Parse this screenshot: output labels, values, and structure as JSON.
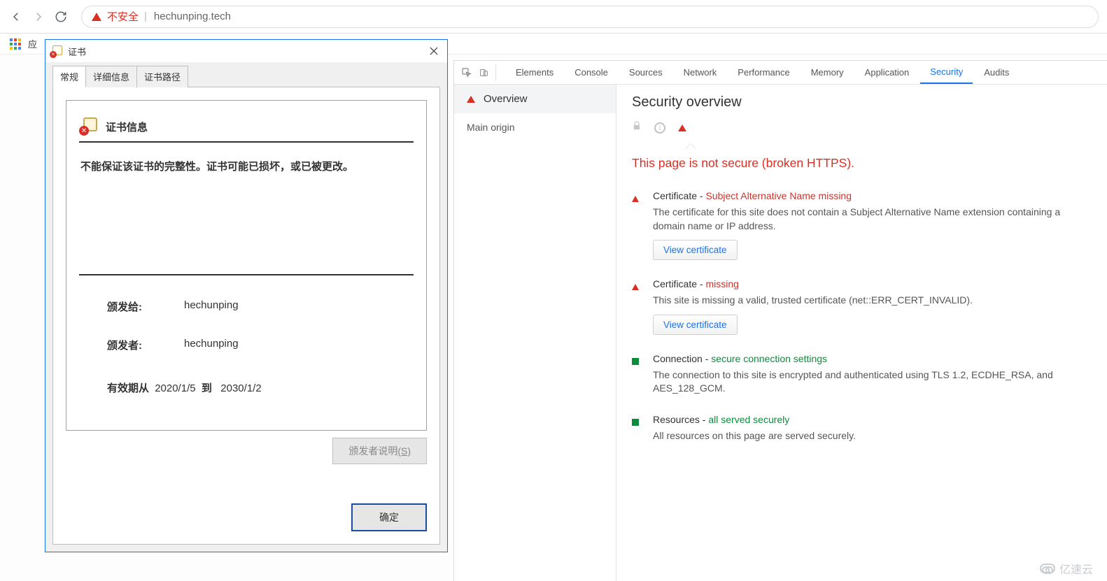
{
  "nav": {
    "not_secure_label": "不安全",
    "url": "hechunping.tech",
    "bookmark_apps": "应"
  },
  "cert_dialog": {
    "title": "证书",
    "tabs": {
      "general": "常规",
      "details": "详细信息",
      "cert_path": "证书路径"
    },
    "heading": "证书信息",
    "warn": "不能保证该证书的完整性。证书可能已损坏，或已被更改。",
    "issued_to_label": "颁发给:",
    "issued_to_value": "hechunping",
    "issued_by_label": "颁发者:",
    "issued_by_value": "hechunping",
    "valid_from_label": "有效期从",
    "valid_from": "2020/1/5",
    "valid_to_label": "到",
    "valid_to": "2030/1/2",
    "issuer_statement": "颁发者说明",
    "issuer_statement_key": "(S)",
    "ok": "确定"
  },
  "devtools": {
    "tabs": {
      "elements": "Elements",
      "console": "Console",
      "sources": "Sources",
      "network": "Network",
      "performance": "Performance",
      "memory": "Memory",
      "application": "Application",
      "security": "Security",
      "audits": "Audits"
    },
    "sidebar": {
      "overview": "Overview",
      "main_origin": "Main origin"
    },
    "main": {
      "header": "Security overview",
      "headline": "This page is not secure (broken HTTPS).",
      "cert1_title": "Certificate - ",
      "cert1_accent": "Subject Alternative Name missing",
      "cert1_desc": "The certificate for this site does not contain a Subject Alternative Name extension containing a domain name or IP address.",
      "view_certificate": "View certificate",
      "cert2_title": "Certificate - ",
      "cert2_accent": "missing",
      "cert2_desc": "This site is missing a valid, trusted certificate (net::ERR_CERT_INVALID).",
      "conn_title": "Connection - ",
      "conn_accent": "secure connection settings",
      "conn_desc": "The connection to this site is encrypted and authenticated using TLS 1.2, ECDHE_RSA, and AES_128_GCM.",
      "res_title": "Resources - ",
      "res_accent": "all served securely",
      "res_desc": "All resources on this page are served securely."
    }
  },
  "watermark": "亿速云"
}
